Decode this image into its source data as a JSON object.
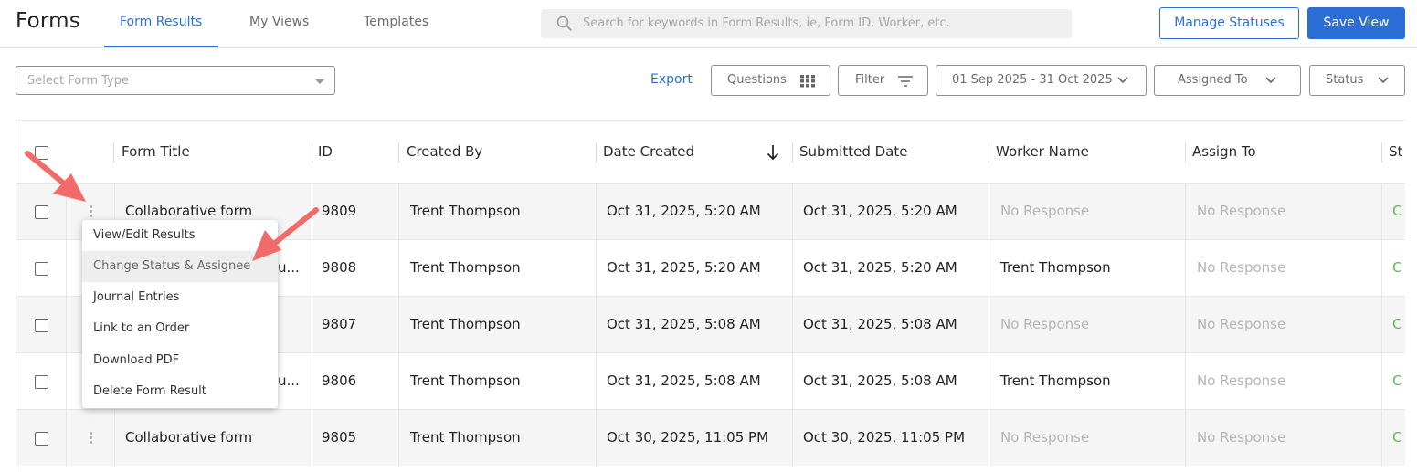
{
  "header": {
    "app_title": "Forms",
    "tabs": [
      {
        "label": "Form Results",
        "active": true
      },
      {
        "label": "My Views",
        "active": false
      },
      {
        "label": "Templates",
        "active": false
      }
    ],
    "search_placeholder": "Search for keywords in Form Results, ie, Form ID, Worker, etc.",
    "manage_statuses_label": "Manage Statuses",
    "save_view_label": "Save View"
  },
  "filters": {
    "form_type_placeholder": "Select Form Type",
    "export_label": "Export",
    "questions_label": "Questions",
    "filter_label": "Filter",
    "date_range": "01 Sep 2025 - 31 Oct 2025",
    "assigned_to_label": "Assigned To",
    "status_label": "Status"
  },
  "table": {
    "columns": [
      "Form Title",
      "ID",
      "Created By",
      "Date Created",
      "Submitted Date",
      "Worker Name",
      "Assign To",
      "St"
    ],
    "sort_column": "Date Created",
    "sort_direction": "descending",
    "rows": [
      {
        "title": "Collaborative form",
        "id": "9809",
        "created_by": "Trent Thompson",
        "date_created": "Oct 31, 2025, 5:20 AM",
        "submitted": "Oct 31, 2025, 5:20 AM",
        "worker": "No Response",
        "worker_empty": true,
        "assign_to": "No Response",
        "status": "C"
      },
      {
        "title": "u...",
        "id": "9808",
        "created_by": "Trent Thompson",
        "date_created": "Oct 31, 2025, 5:20 AM",
        "submitted": "Oct 31, 2025, 5:20 AM",
        "worker": "Trent Thompson",
        "worker_empty": false,
        "assign_to": "No Response",
        "status": "C"
      },
      {
        "title": "",
        "id": "9807",
        "created_by": "Trent Thompson",
        "date_created": "Oct 31, 2025, 5:08 AM",
        "submitted": "Oct 31, 2025, 5:08 AM",
        "worker": "No Response",
        "worker_empty": true,
        "assign_to": "No Response",
        "status": "C"
      },
      {
        "title": "u...",
        "id": "9806",
        "created_by": "Trent Thompson",
        "date_created": "Oct 31, 2025, 5:08 AM",
        "submitted": "Oct 31, 2025, 5:08 AM",
        "worker": "Trent Thompson",
        "worker_empty": false,
        "assign_to": "No Response",
        "status": "C"
      },
      {
        "title": "Collaborative form",
        "id": "9805",
        "created_by": "Trent Thompson",
        "date_created": "Oct 30, 2025, 11:05 PM",
        "submitted": "Oct 30, 2025, 11:05 PM",
        "worker": "No Response",
        "worker_empty": true,
        "assign_to": "No Response",
        "status": "C"
      }
    ]
  },
  "context_menu": {
    "items": [
      {
        "label": "View/Edit Results"
      },
      {
        "label": "Change Status & Assignee",
        "highlighted": true
      },
      {
        "label": "Journal Entries"
      },
      {
        "label": "Link to an Order"
      },
      {
        "label": "Download PDF"
      },
      {
        "label": "Delete Form Result"
      }
    ]
  },
  "colors": {
    "accent": "#2b6fd6",
    "status_green": "#5cb85c",
    "annotation_arrow": "#f26b6b",
    "muted_text": "#b5b5b5"
  }
}
